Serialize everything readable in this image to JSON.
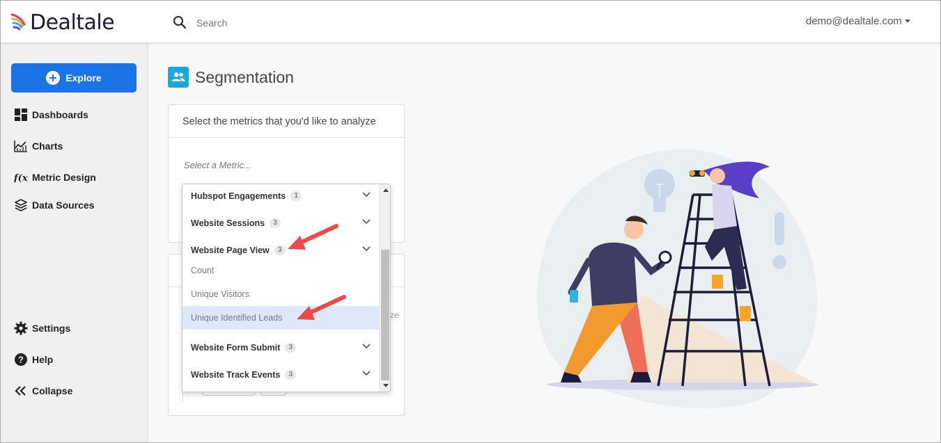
{
  "app": {
    "name": "Dealtale"
  },
  "header": {
    "search_placeholder": "Search",
    "user_email": "demo@dealtale.com"
  },
  "sidebar": {
    "explore_label": "Explore",
    "items": [
      {
        "label": "Dashboards",
        "icon": "dashboard-icon"
      },
      {
        "label": "Charts",
        "icon": "chart-icon"
      },
      {
        "label": "Metric Design",
        "icon": "function-icon"
      },
      {
        "label": "Data Sources",
        "icon": "layers-icon"
      }
    ],
    "bottom_items": [
      {
        "label": "Settings",
        "icon": "gear-icon"
      },
      {
        "label": "Help",
        "icon": "help-icon"
      },
      {
        "label": "Collapse",
        "icon": "collapse-icon"
      }
    ]
  },
  "main": {
    "title": "Segmentation",
    "metrics_card": {
      "heading": "Select the metrics that you'd like to analyze",
      "metric_placeholder": "Select a Metric..."
    },
    "second_card": {
      "truncated_text": "ze"
    }
  },
  "dropdown": {
    "groups": [
      {
        "label": "Hubspot Engagements",
        "count": "1",
        "expanded": false
      },
      {
        "label": "Website Sessions",
        "count": "3",
        "expanded": false
      },
      {
        "label": "Website Page View",
        "count": "3",
        "expanded": true
      },
      {
        "label": "Website Form Submit",
        "count": "3",
        "expanded": false
      },
      {
        "label": "Website Track Events",
        "count": "3",
        "expanded": false
      }
    ],
    "options": [
      {
        "label": "Count",
        "selected": false
      },
      {
        "label": "Unique Visitors",
        "selected": false
      },
      {
        "label": "Unique Identified Leads",
        "selected": true
      }
    ]
  },
  "colors": {
    "brand_blue": "#1a74e8",
    "title_icon": "#1aa7d9",
    "selected_option": "#dde9fb",
    "annotation_arrow": "#f04848"
  }
}
